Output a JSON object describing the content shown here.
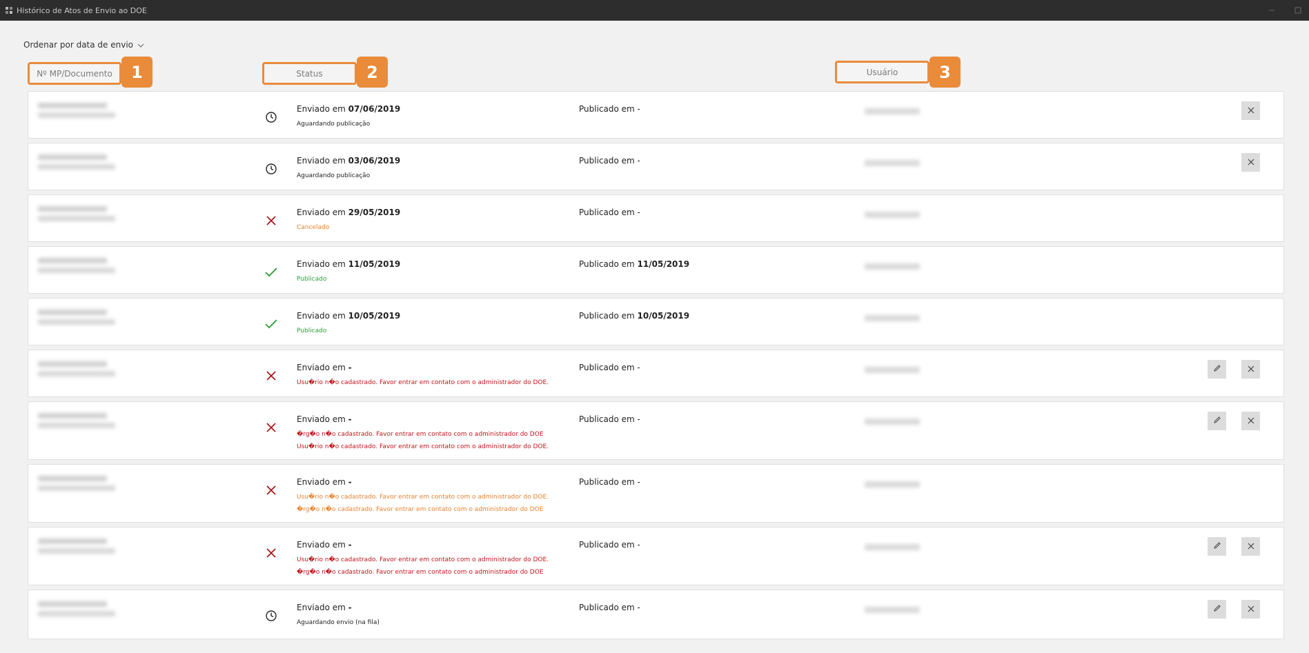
{
  "window": {
    "title": "Histórico de Atos de Envio ao DOE",
    "app_icon": "app-logo-icon",
    "controls": [
      "minimize-icon",
      "maximize-icon"
    ]
  },
  "sort": {
    "label": "Ordenar por data de envio",
    "icon": "chevron-down-icon"
  },
  "columns": {
    "doc": "Nº MP/Documento",
    "status": "Status",
    "user": "Usuário"
  },
  "callouts": [
    "1",
    "2",
    "3"
  ],
  "colors": {
    "accent": "#e98b39",
    "pending": "#222222",
    "cancel": "#a31515",
    "published": "#2e9e3a",
    "orange_text": "#e8822d",
    "red_text": "#c0141b"
  },
  "labels": {
    "sent_prefix": "Enviado em",
    "pub_prefix": "Publicado em"
  },
  "rows": [
    {
      "icon": "clock-icon",
      "sent": "07/06/2019",
      "pub": "-",
      "messages": [
        {
          "text": "Aguardando publicação",
          "tone": "normal"
        }
      ],
      "edit": false,
      "delete": true
    },
    {
      "icon": "clock-icon",
      "sent": "03/06/2019",
      "pub": "-",
      "messages": [
        {
          "text": "Aguardando publicação",
          "tone": "normal"
        }
      ],
      "edit": false,
      "delete": true
    },
    {
      "icon": "x-icon",
      "sent": "29/05/2019",
      "pub": "-",
      "messages": [
        {
          "text": "Cancelado",
          "tone": "orange"
        }
      ],
      "edit": false,
      "delete": false
    },
    {
      "icon": "check-icon",
      "sent": "11/05/2019",
      "pub": "11/05/2019",
      "messages": [
        {
          "text": "Publicado",
          "tone": "green"
        }
      ],
      "edit": false,
      "delete": false
    },
    {
      "icon": "check-icon",
      "sent": "10/05/2019",
      "pub": "10/05/2019",
      "messages": [
        {
          "text": "Publicado",
          "tone": "green"
        }
      ],
      "edit": false,
      "delete": false
    },
    {
      "icon": "x-icon",
      "sent": "-",
      "pub": "-",
      "messages": [
        {
          "text": "Usu�rio n�o cadastrado. Favor entrar em contato com o administrador do DOE.",
          "tone": "red"
        }
      ],
      "edit": true,
      "delete": true
    },
    {
      "icon": "x-icon",
      "sent": "-",
      "pub": "-",
      "messages": [
        {
          "text": "�rg�o n�o cadastrado. Favor entrar em contato com o administrador do DOE",
          "tone": "red"
        },
        {
          "text": "Usu�rio n�o cadastrado. Favor entrar em contato com o administrador do DOE.",
          "tone": "red"
        }
      ],
      "edit": true,
      "delete": true
    },
    {
      "icon": "x-icon",
      "sent": "-",
      "pub": "-",
      "messages": [
        {
          "text": "Usu�rio n�o cadastrado. Favor entrar em contato com o administrador do DOE.",
          "tone": "orange"
        },
        {
          "text": "�rg�o n�o cadastrado. Favor entrar em contato com o administrador do DOE",
          "tone": "orange"
        }
      ],
      "edit": false,
      "delete": false
    },
    {
      "icon": "x-icon",
      "sent": "-",
      "pub": "-",
      "messages": [
        {
          "text": "Usu�rio n�o cadastrado. Favor entrar em contato com o administrador do DOE.",
          "tone": "red"
        },
        {
          "text": "�rg�o n�o cadastrado. Favor entrar em contato com o administrador do DOE",
          "tone": "red"
        }
      ],
      "edit": true,
      "delete": true
    },
    {
      "icon": "clock-icon",
      "sent": "-",
      "pub": "-",
      "messages": [
        {
          "text": "Aguardando envio (na fila)",
          "tone": "normal"
        }
      ],
      "edit": true,
      "delete": true
    }
  ]
}
